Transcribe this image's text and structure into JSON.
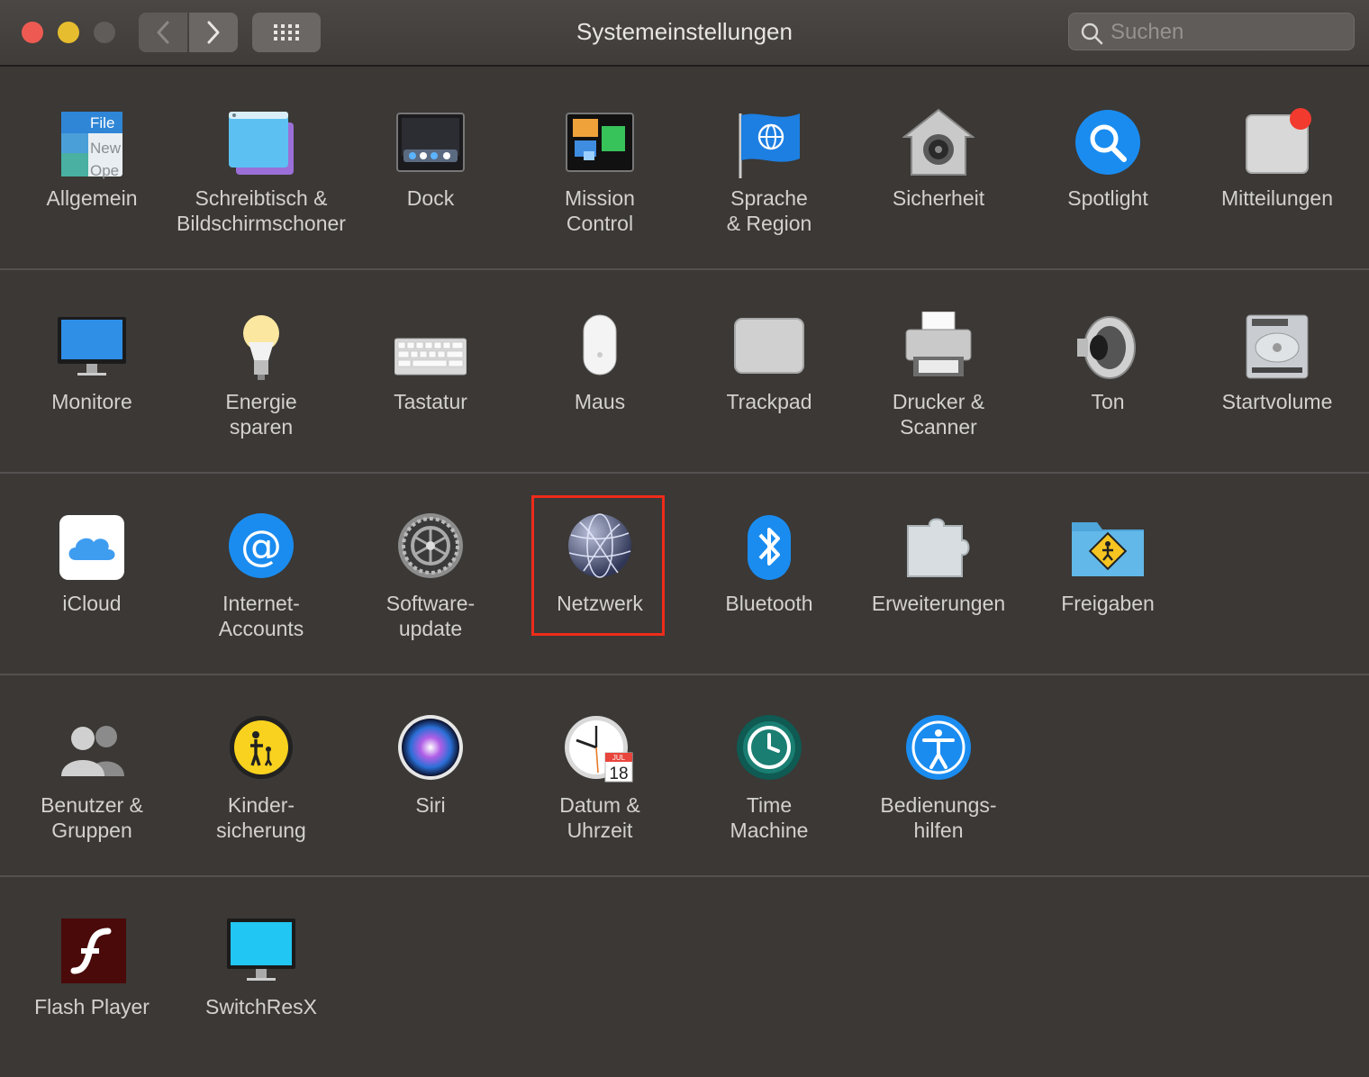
{
  "window": {
    "title": "Systemeinstellungen",
    "search_placeholder": "Suchen"
  },
  "rows": [
    [
      {
        "id": "allgemein",
        "label": "Allgemein",
        "icon": "general-icon",
        "sub": {
          "file": "File",
          "new": "New",
          "open": "Ope"
        }
      },
      {
        "id": "schreibtisch",
        "label": "Schreibtisch &\nBildschirmschoner",
        "icon": "desktop-screensaver-icon"
      },
      {
        "id": "dock",
        "label": "Dock",
        "icon": "dock-icon"
      },
      {
        "id": "mission",
        "label": "Mission\nControl",
        "icon": "mission-control-icon"
      },
      {
        "id": "sprache",
        "label": "Sprache\n& Region",
        "icon": "language-region-flag-icon"
      },
      {
        "id": "sicherheit",
        "label": "Sicherheit",
        "icon": "security-house-icon"
      },
      {
        "id": "spotlight",
        "label": "Spotlight",
        "icon": "spotlight-magnifier-icon"
      },
      {
        "id": "mitteilungen",
        "label": "Mitteilungen",
        "icon": "notifications-icon"
      }
    ],
    [
      {
        "id": "monitore",
        "label": "Monitore",
        "icon": "display-monitor-icon"
      },
      {
        "id": "energie",
        "label": "Energie\nsparen",
        "icon": "lightbulb-icon"
      },
      {
        "id": "tastatur",
        "label": "Tastatur",
        "icon": "keyboard-icon"
      },
      {
        "id": "maus",
        "label": "Maus",
        "icon": "mouse-icon"
      },
      {
        "id": "trackpad",
        "label": "Trackpad",
        "icon": "trackpad-icon"
      },
      {
        "id": "drucker",
        "label": "Drucker &\nScanner",
        "icon": "printer-icon"
      },
      {
        "id": "ton",
        "label": "Ton",
        "icon": "speaker-icon"
      },
      {
        "id": "startvolume",
        "label": "Startvolume",
        "icon": "hard-drive-icon"
      }
    ],
    [
      {
        "id": "icloud",
        "label": "iCloud",
        "icon": "icloud-icon"
      },
      {
        "id": "internet",
        "label": "Internet-\nAccounts",
        "icon": "at-sign-icon"
      },
      {
        "id": "software",
        "label": "Software-\nupdate",
        "icon": "gear-icon"
      },
      {
        "id": "netzwerk",
        "label": "Netzwerk",
        "icon": "network-globe-icon"
      },
      {
        "id": "bluetooth",
        "label": "Bluetooth",
        "icon": "bluetooth-icon"
      },
      {
        "id": "erweiterungen",
        "label": "Erweiterungen",
        "icon": "puzzle-piece-icon"
      },
      {
        "id": "freigaben",
        "label": "Freigaben",
        "icon": "sharing-folder-icon"
      }
    ],
    [
      {
        "id": "benutzer",
        "label": "Benutzer &\nGruppen",
        "icon": "users-icon"
      },
      {
        "id": "kinder",
        "label": "Kinder-\nsicherung",
        "icon": "parental-controls-icon"
      },
      {
        "id": "siri",
        "label": "Siri",
        "icon": "siri-icon"
      },
      {
        "id": "datum",
        "label": "Datum &\nUhrzeit",
        "icon": "clock-calendar-icon",
        "sub": {
          "month": "JUL",
          "day": "18"
        }
      },
      {
        "id": "timemachine",
        "label": "Time\nMachine",
        "icon": "time-machine-icon"
      },
      {
        "id": "bedienung",
        "label": "Bedienungs-\nhilfen",
        "icon": "accessibility-icon"
      }
    ],
    [
      {
        "id": "flash",
        "label": "Flash Player",
        "icon": "flash-player-icon"
      },
      {
        "id": "switchresx",
        "label": "SwitchResX",
        "icon": "switchresx-monitor-icon"
      }
    ]
  ],
  "colors": {
    "background": "#3b3835",
    "highlight": "#ef2b1a",
    "close": "#ee5a52",
    "minimize": "#e6bd2e"
  }
}
